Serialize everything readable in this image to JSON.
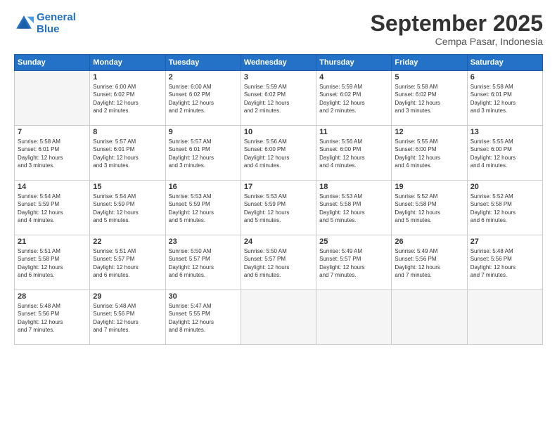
{
  "logo": {
    "line1": "General",
    "line2": "Blue"
  },
  "title": "September 2025",
  "subtitle": "Cempa Pasar, Indonesia",
  "header_days": [
    "Sunday",
    "Monday",
    "Tuesday",
    "Wednesday",
    "Thursday",
    "Friday",
    "Saturday"
  ],
  "weeks": [
    [
      {
        "day": "",
        "info": ""
      },
      {
        "day": "1",
        "info": "Sunrise: 6:00 AM\nSunset: 6:02 PM\nDaylight: 12 hours\nand 2 minutes."
      },
      {
        "day": "2",
        "info": "Sunrise: 6:00 AM\nSunset: 6:02 PM\nDaylight: 12 hours\nand 2 minutes."
      },
      {
        "day": "3",
        "info": "Sunrise: 5:59 AM\nSunset: 6:02 PM\nDaylight: 12 hours\nand 2 minutes."
      },
      {
        "day": "4",
        "info": "Sunrise: 5:59 AM\nSunset: 6:02 PM\nDaylight: 12 hours\nand 2 minutes."
      },
      {
        "day": "5",
        "info": "Sunrise: 5:58 AM\nSunset: 6:02 PM\nDaylight: 12 hours\nand 3 minutes."
      },
      {
        "day": "6",
        "info": "Sunrise: 5:58 AM\nSunset: 6:01 PM\nDaylight: 12 hours\nand 3 minutes."
      }
    ],
    [
      {
        "day": "7",
        "info": "Sunrise: 5:58 AM\nSunset: 6:01 PM\nDaylight: 12 hours\nand 3 minutes."
      },
      {
        "day": "8",
        "info": "Sunrise: 5:57 AM\nSunset: 6:01 PM\nDaylight: 12 hours\nand 3 minutes."
      },
      {
        "day": "9",
        "info": "Sunrise: 5:57 AM\nSunset: 6:01 PM\nDaylight: 12 hours\nand 3 minutes."
      },
      {
        "day": "10",
        "info": "Sunrise: 5:56 AM\nSunset: 6:00 PM\nDaylight: 12 hours\nand 4 minutes."
      },
      {
        "day": "11",
        "info": "Sunrise: 5:56 AM\nSunset: 6:00 PM\nDaylight: 12 hours\nand 4 minutes."
      },
      {
        "day": "12",
        "info": "Sunrise: 5:55 AM\nSunset: 6:00 PM\nDaylight: 12 hours\nand 4 minutes."
      },
      {
        "day": "13",
        "info": "Sunrise: 5:55 AM\nSunset: 6:00 PM\nDaylight: 12 hours\nand 4 minutes."
      }
    ],
    [
      {
        "day": "14",
        "info": "Sunrise: 5:54 AM\nSunset: 5:59 PM\nDaylight: 12 hours\nand 4 minutes."
      },
      {
        "day": "15",
        "info": "Sunrise: 5:54 AM\nSunset: 5:59 PM\nDaylight: 12 hours\nand 5 minutes."
      },
      {
        "day": "16",
        "info": "Sunrise: 5:53 AM\nSunset: 5:59 PM\nDaylight: 12 hours\nand 5 minutes."
      },
      {
        "day": "17",
        "info": "Sunrise: 5:53 AM\nSunset: 5:59 PM\nDaylight: 12 hours\nand 5 minutes."
      },
      {
        "day": "18",
        "info": "Sunrise: 5:53 AM\nSunset: 5:58 PM\nDaylight: 12 hours\nand 5 minutes."
      },
      {
        "day": "19",
        "info": "Sunrise: 5:52 AM\nSunset: 5:58 PM\nDaylight: 12 hours\nand 5 minutes."
      },
      {
        "day": "20",
        "info": "Sunrise: 5:52 AM\nSunset: 5:58 PM\nDaylight: 12 hours\nand 6 minutes."
      }
    ],
    [
      {
        "day": "21",
        "info": "Sunrise: 5:51 AM\nSunset: 5:58 PM\nDaylight: 12 hours\nand 6 minutes."
      },
      {
        "day": "22",
        "info": "Sunrise: 5:51 AM\nSunset: 5:57 PM\nDaylight: 12 hours\nand 6 minutes."
      },
      {
        "day": "23",
        "info": "Sunrise: 5:50 AM\nSunset: 5:57 PM\nDaylight: 12 hours\nand 6 minutes."
      },
      {
        "day": "24",
        "info": "Sunrise: 5:50 AM\nSunset: 5:57 PM\nDaylight: 12 hours\nand 6 minutes."
      },
      {
        "day": "25",
        "info": "Sunrise: 5:49 AM\nSunset: 5:57 PM\nDaylight: 12 hours\nand 7 minutes."
      },
      {
        "day": "26",
        "info": "Sunrise: 5:49 AM\nSunset: 5:56 PM\nDaylight: 12 hours\nand 7 minutes."
      },
      {
        "day": "27",
        "info": "Sunrise: 5:48 AM\nSunset: 5:56 PM\nDaylight: 12 hours\nand 7 minutes."
      }
    ],
    [
      {
        "day": "28",
        "info": "Sunrise: 5:48 AM\nSunset: 5:56 PM\nDaylight: 12 hours\nand 7 minutes."
      },
      {
        "day": "29",
        "info": "Sunrise: 5:48 AM\nSunset: 5:56 PM\nDaylight: 12 hours\nand 7 minutes."
      },
      {
        "day": "30",
        "info": "Sunrise: 5:47 AM\nSunset: 5:55 PM\nDaylight: 12 hours\nand 8 minutes."
      },
      {
        "day": "",
        "info": ""
      },
      {
        "day": "",
        "info": ""
      },
      {
        "day": "",
        "info": ""
      },
      {
        "day": "",
        "info": ""
      }
    ]
  ]
}
